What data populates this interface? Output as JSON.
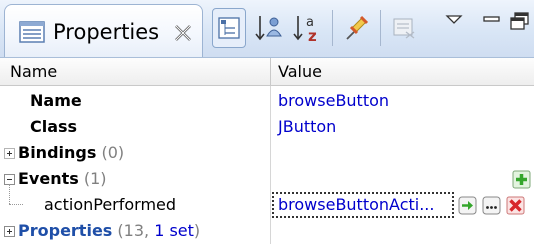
{
  "tab": {
    "title": "Properties",
    "icon": "properties-view-icon",
    "close_icon": "close-icon"
  },
  "toolbar": {
    "buttons": [
      {
        "name": "show-categories-icon",
        "active": true
      },
      {
        "name": "sort-by-name-icon"
      },
      {
        "name": "sort-alphabetical-icon"
      },
      {
        "name": "pin-icon"
      },
      {
        "name": "restore-default-icon",
        "disabled": true
      },
      {
        "name": "view-menu-chevron-icon"
      },
      {
        "name": "minimize-icon"
      },
      {
        "name": "maximize-icon"
      }
    ]
  },
  "table": {
    "col_name": "Name",
    "col_value": "Value"
  },
  "rows": {
    "name": {
      "label": "Name",
      "value": "browseButton"
    },
    "class": {
      "label": "Class",
      "value": "JButton"
    },
    "bindings": {
      "label": "Bindings",
      "count": "(0)"
    },
    "events": {
      "label": "Events",
      "count": "(1)"
    },
    "action": {
      "label": "actionPerformed",
      "value": "browseButtonActi..."
    },
    "properties": {
      "label": "Properties",
      "count_prefix": "(13, ",
      "count_set": "1 set",
      "count_suffix": ")"
    }
  },
  "colors": {
    "value_blue": "#0000cc",
    "properties_blue": "#1f4fa8",
    "count_gray": "#808080",
    "add_green": "#35a62c",
    "delete_red": "#d8262b"
  }
}
